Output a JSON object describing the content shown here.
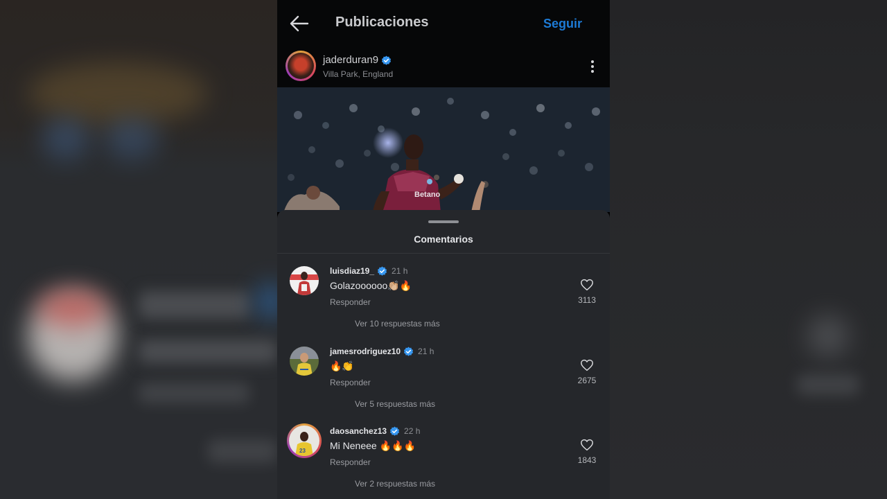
{
  "header": {
    "title": "Publicaciones",
    "follow_label": "Seguir"
  },
  "post": {
    "username": "jaderduran9",
    "location": "Villa Park, England"
  },
  "comments_sheet": {
    "title": "Comentarios",
    "comments": [
      {
        "username": "luisdiaz19_",
        "time": "21 h",
        "text": "Golazoooooo👏🏼🔥",
        "reply_label": "Responder",
        "more_replies": "Ver 10 respuestas más",
        "likes": "3113"
      },
      {
        "username": "jamesrodriguez10",
        "time": "21 h",
        "text": "🔥👏",
        "reply_label": "Responder",
        "more_replies": "Ver 5 respuestas más",
        "likes": "2675"
      },
      {
        "username": "daosanchez13",
        "time": "22 h",
        "text": "Mi Neneee 🔥🔥🔥",
        "reply_label": "Responder",
        "more_replies": "Ver 2 respuestas más",
        "likes": "1843"
      }
    ]
  },
  "colors": {
    "accent": "#1d7bd6",
    "verified": "#3797f0",
    "sheet_bg": "#25272b"
  }
}
